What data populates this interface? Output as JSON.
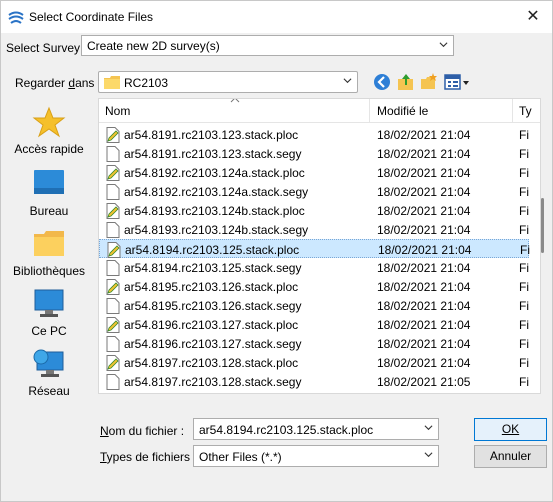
{
  "window": {
    "title": "Select Coordinate Files",
    "close_glyph": "✕"
  },
  "survey": {
    "label": "Select Survey",
    "value": "Create new 2D survey(s)"
  },
  "lookin": {
    "label_prefix": "Regarder ",
    "label_accel": "d",
    "label_suffix": "ans :",
    "value": "RC2103"
  },
  "toolbar": {
    "icons": [
      "back-icon",
      "up-folder-icon",
      "new-folder-icon",
      "view-menu-icon"
    ]
  },
  "places": [
    {
      "label": "Accès rapide",
      "icon": "star-icon"
    },
    {
      "label": "Bureau",
      "icon": "desktop-icon"
    },
    {
      "label": "Bibliothèques",
      "icon": "library-icon"
    },
    {
      "label": "Ce PC",
      "icon": "computer-icon"
    },
    {
      "label": "Réseau",
      "icon": "network-icon"
    }
  ],
  "columns": {
    "name": "Nom",
    "modified": "Modifié le",
    "type": "Ty"
  },
  "files": [
    {
      "name": "ar54.8191.rc2103.123.stack.ploc",
      "date": "18/02/2021 21:04",
      "type": "Fi",
      "kind": "ploc",
      "selected": false
    },
    {
      "name": "ar54.8191.rc2103.123.stack.segy",
      "date": "18/02/2021 21:04",
      "type": "Fi",
      "kind": "segy",
      "selected": false
    },
    {
      "name": "ar54.8192.rc2103.124a.stack.ploc",
      "date": "18/02/2021 21:04",
      "type": "Fi",
      "kind": "ploc",
      "selected": false
    },
    {
      "name": "ar54.8192.rc2103.124a.stack.segy",
      "date": "18/02/2021 21:04",
      "type": "Fi",
      "kind": "segy",
      "selected": false
    },
    {
      "name": "ar54.8193.rc2103.124b.stack.ploc",
      "date": "18/02/2021 21:04",
      "type": "Fi",
      "kind": "ploc",
      "selected": false
    },
    {
      "name": "ar54.8193.rc2103.124b.stack.segy",
      "date": "18/02/2021 21:04",
      "type": "Fi",
      "kind": "segy",
      "selected": false
    },
    {
      "name": "ar54.8194.rc2103.125.stack.ploc",
      "date": "18/02/2021 21:04",
      "type": "Fi",
      "kind": "ploc",
      "selected": true
    },
    {
      "name": "ar54.8194.rc2103.125.stack.segy",
      "date": "18/02/2021 21:04",
      "type": "Fi",
      "kind": "segy",
      "selected": false
    },
    {
      "name": "ar54.8195.rc2103.126.stack.ploc",
      "date": "18/02/2021 21:04",
      "type": "Fi",
      "kind": "ploc",
      "selected": false
    },
    {
      "name": "ar54.8195.rc2103.126.stack.segy",
      "date": "18/02/2021 21:04",
      "type": "Fi",
      "kind": "segy",
      "selected": false
    },
    {
      "name": "ar54.8196.rc2103.127.stack.ploc",
      "date": "18/02/2021 21:04",
      "type": "Fi",
      "kind": "ploc",
      "selected": false
    },
    {
      "name": "ar54.8196.rc2103.127.stack.segy",
      "date": "18/02/2021 21:04",
      "type": "Fi",
      "kind": "segy",
      "selected": false
    },
    {
      "name": "ar54.8197.rc2103.128.stack.ploc",
      "date": "18/02/2021 21:04",
      "type": "Fi",
      "kind": "ploc",
      "selected": false
    },
    {
      "name": "ar54.8197.rc2103.128.stack.segy",
      "date": "18/02/2021 21:05",
      "type": "Fi",
      "kind": "segy",
      "selected": false
    }
  ],
  "filename": {
    "label_accel": "N",
    "label_rest": "om du fichier :",
    "value": "ar54.8194.rc2103.125.stack.ploc"
  },
  "filetype": {
    "label_accel": "T",
    "label_rest": "ypes de fichiers :",
    "value": "Other Files (*.*)"
  },
  "buttons": {
    "ok": "OK",
    "cancel": "Annuler"
  },
  "colors": {
    "selection": "#cce8ff",
    "accent": "#0078d4",
    "folder": "#f5c451"
  }
}
